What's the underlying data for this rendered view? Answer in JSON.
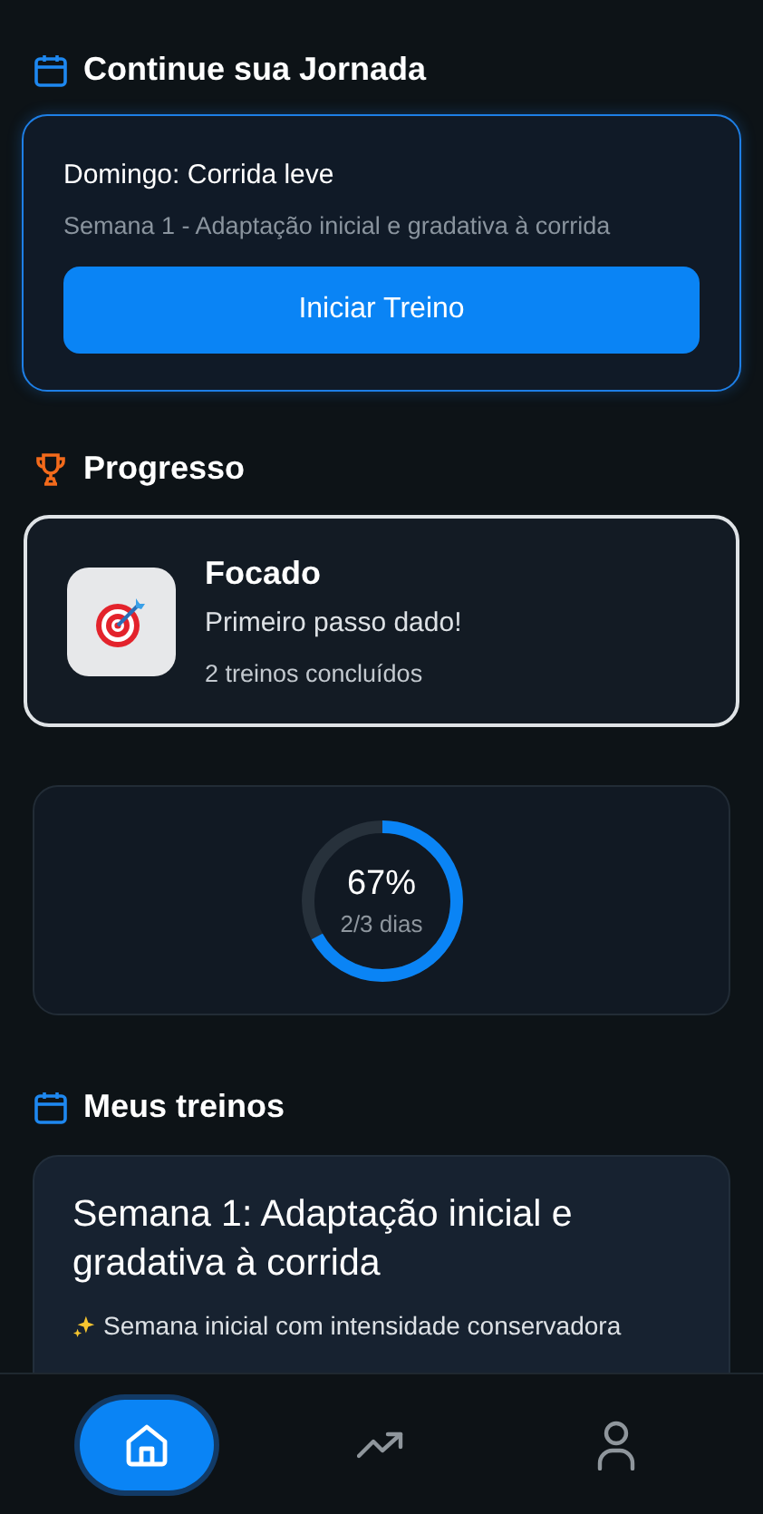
{
  "journey": {
    "heading": "Continue sua Jornada",
    "workout": "Domingo: Corrida leve",
    "week": "Semana 1 - Adaptação inicial e gradativa à corrida",
    "button": "Iniciar Treino"
  },
  "progress": {
    "heading": "Progresso",
    "badge": {
      "title": "Focado",
      "subtitle": "Primeiro passo dado!",
      "count": "2 treinos concluídos"
    },
    "ring": {
      "level": 0.67,
      "percent": "67%",
      "days": "2/3 dias"
    }
  },
  "workouts": {
    "heading": "Meus treinos",
    "items": [
      {
        "title": "Semana 1: Adaptação inicial e gradativa à corrida",
        "description": "Semana inicial com intensidade conservadora"
      }
    ]
  },
  "nav": {
    "items": [
      {
        "kind": "home",
        "selected": true
      },
      {
        "kind": "trend",
        "selected": false
      },
      {
        "kind": "profile",
        "selected": false
      }
    ]
  }
}
